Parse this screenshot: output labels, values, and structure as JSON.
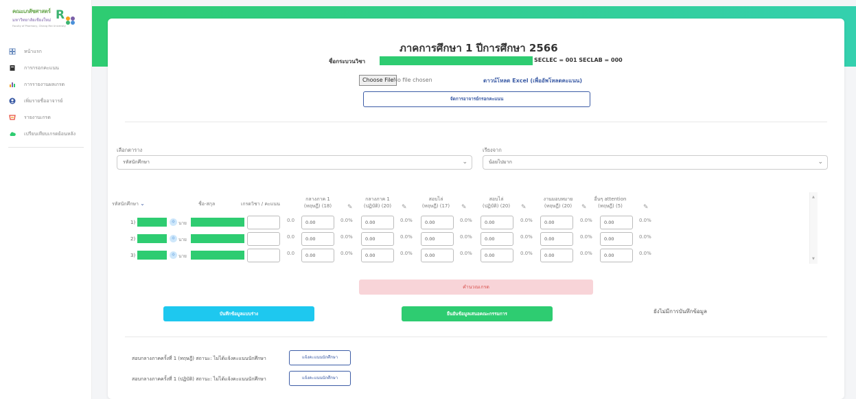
{
  "sidebar": {
    "logo": {
      "line1": "คณะเภสัชศาสตร์",
      "line2": "มหาวิทยาลัยเชียงใหม่",
      "line3": "Faculty of Pharmacy, Chiang Mai University",
      "mark": "R",
      "dot_colors": [
        "#f7a21b",
        "#7a5fa8",
        "#3cb371",
        "#4a90d9"
      ]
    },
    "items": [
      {
        "label": "หน้าแรก",
        "icon": "home-icon",
        "color": "#6c8ebf"
      },
      {
        "label": "การกรอกคะแนน",
        "icon": "document-icon",
        "color": "#333333"
      },
      {
        "label": "การรายงานผลเกรด",
        "icon": "bar-chart-icon",
        "color": "#f7a21b"
      },
      {
        "label": "เพิ่มรายชื่ออาจารย์",
        "icon": "user-circle-icon",
        "color": "#3b5ba5"
      },
      {
        "label": "รายงานเกรด",
        "icon": "report-icon",
        "color": "#e74c3c"
      },
      {
        "label": "เปรียบเทียบเกรดย้อนหลัง",
        "icon": "cloud-icon",
        "color": "#2ecc71"
      }
    ]
  },
  "header": {
    "title": "ภาคการศึกษา 1 ปีการศึกษา 2566",
    "course_label": "ชื่อกระบวนวิชา",
    "sections": "SECLEC = 001 SECLAB = 000"
  },
  "upload": {
    "file_button": "Choose File",
    "file_status": "No file chosen",
    "download_link": "ดาวน์โหลด Excel (เพื่ออัพโหลดคะแนน)",
    "manage_button": "จัดการอาจารย์กรอกคะแนน"
  },
  "filters": {
    "table_label": "เลือกตาราง",
    "table_value": "รหัสนักศึกษา",
    "sort_label": "เรียงจาก",
    "sort_value": "น้อยไปมาก"
  },
  "table": {
    "headers": {
      "student_id": "รหัสนักศึกษา",
      "name": "ชื่อ-สกุล",
      "grade": "เกรดวิชา / คะแนน",
      "cols": [
        {
          "line1": "กลางภาค 1",
          "line2": "(ทฤษฎี) (18)"
        },
        {
          "line1": "กลางภาค 1",
          "line2": "(ปฏิบัติ) (20)"
        },
        {
          "line1": "สอบไล่",
          "line2": "(ทฤษฎี) (17)"
        },
        {
          "line1": "สอบไล่",
          "line2": "(ปฏิบัติ) (20)"
        },
        {
          "line1": "งานมอบหมาย",
          "line2": "(ทฤษฎี) (20)"
        },
        {
          "line1": "อื่นๆ attention",
          "line2": "(ทฤษฎี) (5)"
        }
      ]
    },
    "rows": [
      {
        "num": "1)",
        "prefix": "นาย",
        "total": "0.0",
        "scores": [
          "0.00",
          "0.00",
          "0.00",
          "0.00",
          "0.00",
          "0.00"
        ],
        "pcts": [
          "0.0%",
          "0.0%",
          "0.0%",
          "0.0%",
          "0.0%",
          "0.0%"
        ]
      },
      {
        "num": "2)",
        "prefix": "นาย",
        "total": "0.0",
        "scores": [
          "0.00",
          "0.00",
          "0.00",
          "0.00",
          "0.00",
          "0.00"
        ],
        "pcts": [
          "0.0%",
          "0.0%",
          "0.0%",
          "0.0%",
          "0.0%",
          "0.0%"
        ]
      },
      {
        "num": "3)",
        "prefix": "นาย",
        "total": "0.0",
        "scores": [
          "0.00",
          "0.00",
          "0.00",
          "0.00",
          "0.00",
          "0.00"
        ],
        "pcts": [
          "0.0%",
          "0.0%",
          "0.0%",
          "0.0%",
          "0.0%",
          "0.0%"
        ]
      }
    ]
  },
  "actions": {
    "calc_button": "คำนวณเกรด",
    "draft_button": "บันทึกข้อมูลแบบร่าง",
    "confirm_button": "ยืนยันข้อมูลเสนอคณะกรรมการ",
    "status_text": "ยังไม่มีการบันทึกข้อมูล"
  },
  "notifications": [
    {
      "text": "สอบกลางภาคครั้งที่ 1 (ทฤษฎี) สถานะ: ไม่ได้แจ้งคะแนนนักศึกษา",
      "button": "แจ้งคะแนนนักศึกษา"
    },
    {
      "text": "สอบกลางภาคครั้งที่ 1 (ปฏิบัติ) สถานะ: ไม่ได้แจ้งคะแนนนักศึกษา",
      "button": "แจ้งคะแนนนักศึกษา"
    }
  ],
  "colors": {
    "accent": "#2ecc71",
    "link": "#3b5ba5",
    "danger": "#d9534f",
    "info": "#1ec8ef"
  }
}
